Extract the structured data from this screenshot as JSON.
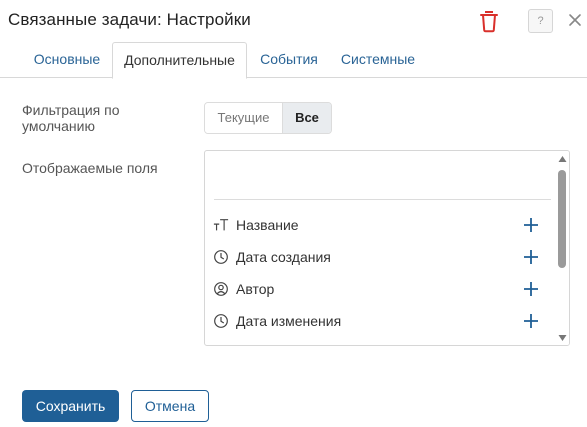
{
  "dialog": {
    "title": "Связанные задачи: Настройки",
    "help_label": "?"
  },
  "tabs": [
    {
      "label": "Основные",
      "active": false
    },
    {
      "label": "Дополнительные",
      "active": true
    },
    {
      "label": "События",
      "active": false
    },
    {
      "label": "Системные",
      "active": false
    }
  ],
  "filter": {
    "label": "Фильтрация по умолчанию",
    "options": [
      {
        "label": "Текущие",
        "selected": false
      },
      {
        "label": "Все",
        "selected": true
      }
    ]
  },
  "fields": {
    "label": "Отображаемые поля",
    "items": [
      {
        "label": "Название",
        "icon": "text-type-icon"
      },
      {
        "label": "Дата создания",
        "icon": "clock-icon"
      },
      {
        "label": "Автор",
        "icon": "user-icon"
      },
      {
        "label": "Дата изменения",
        "icon": "clock-icon"
      }
    ]
  },
  "actions": {
    "save_label": "Сохранить",
    "cancel_label": "Отмена"
  },
  "colors": {
    "primary": "#1f5f96",
    "link": "#2a6496",
    "danger": "#d9302b"
  }
}
